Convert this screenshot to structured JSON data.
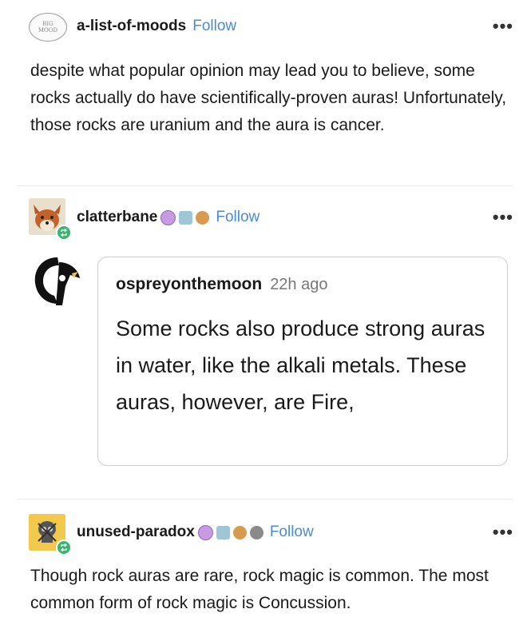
{
  "post1": {
    "avatar_text": "BIG MOOD",
    "username": "a-list-of-moods",
    "follow_label": "Follow",
    "menu": "•••",
    "text": "despite what popular opinion may lead you to believe, some rocks actually do have scientifically-proven auras! Unfortunately, those rocks are uranium and the aura is cancer."
  },
  "post2": {
    "username": "clatterbane",
    "follow_label": "Follow",
    "menu": "•••",
    "quote": {
      "username": "ospreyonthemoon",
      "time": "22h ago",
      "text": "Some rocks also produce strong auras in water, like the alkali metals. These auras, however, are Fire,"
    }
  },
  "post3": {
    "username": "unused-paradox",
    "follow_label": "Follow",
    "menu": "•••",
    "text": "Though rock auras are rare, rock magic is common. The most common form of rock magic is Concussion."
  },
  "colors": {
    "follow": "#4a8bd6",
    "reblog_badge": "#3cb371"
  }
}
